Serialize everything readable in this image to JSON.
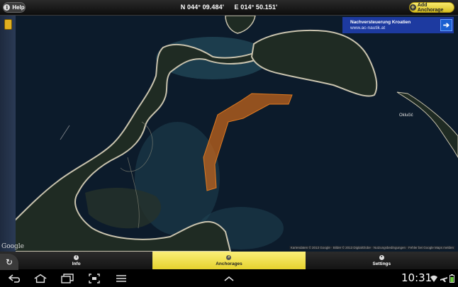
{
  "top_bar": {
    "help_label": "Help",
    "latitude": "N 044° 09.484'",
    "longitude": "E 014° 50.151'",
    "add_anchorage_label": "Add Anchorage"
  },
  "ad": {
    "title": "Nachversteuerung Kroatien",
    "url": "www.ac-nautik.at"
  },
  "map": {
    "place_label": "Oklučić",
    "google_logo": "Google",
    "attribution": "Kartendaten © 2013 Google · Bilder © 2013 DigitalGlobe · Nutzungsbedingungen · Fehler bei Google Maps melden",
    "anchorage_color": "#c8661a"
  },
  "tabs": [
    {
      "label": "Info",
      "icon": "info-icon",
      "active": false
    },
    {
      "label": "Anchorages",
      "icon": "search-icon",
      "active": true
    },
    {
      "label": "Settings",
      "icon": "settings-icon",
      "active": false
    }
  ],
  "status": {
    "time": "10:31"
  },
  "colors": {
    "accent_yellow": "#e6d22d",
    "ad_blue": "#1d3aa0",
    "water": "#0b1a2a"
  }
}
